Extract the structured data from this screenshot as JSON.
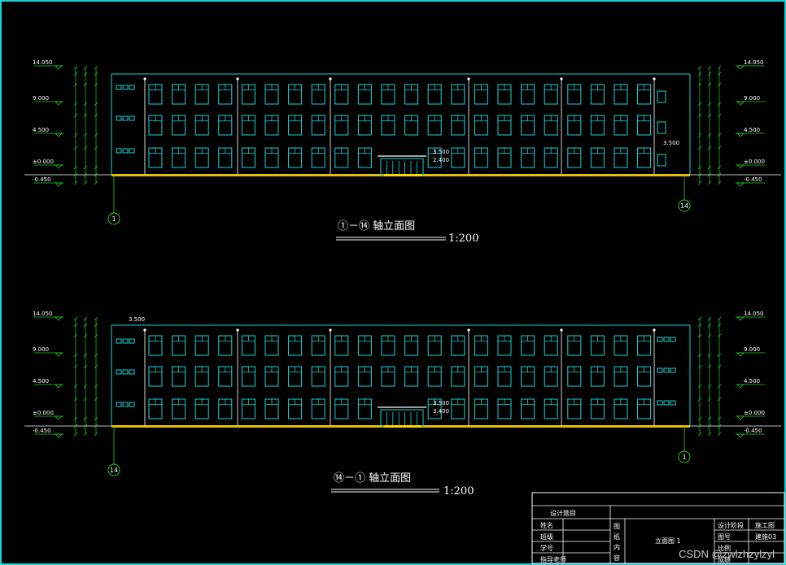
{
  "elevation_top": {
    "title": "①－⑭  轴立面图",
    "scale": "1:200",
    "axis_left": "1",
    "axis_right": "14",
    "levels_left": [
      "14.050",
      "9.000",
      "4.500",
      "±0.000",
      "-0.450"
    ],
    "levels_right": [
      "14.050",
      "9.000",
      "4.500",
      "±0.000",
      "-0.450"
    ],
    "entrance_levels": [
      "3.500",
      "2.400"
    ],
    "side_level": "3.500"
  },
  "elevation_bottom": {
    "title": "⑭－①  轴立面图",
    "scale": "1:200",
    "axis_left": "14",
    "axis_right": "1",
    "levels_left": [
      "14.050",
      "9.000",
      "4.500",
      "±0.000",
      "-0.450"
    ],
    "levels_right": [
      "14.050",
      "9.000",
      "4.500",
      "±0.000",
      "-0.450"
    ],
    "entrance_levels": [
      "3.500",
      "3.400"
    ],
    "side_level": "3.500"
  },
  "title_block": {
    "header": "设计题目",
    "rows": [
      "姓名",
      "班级",
      "学号",
      "指导老师"
    ],
    "content_label": [
      "图",
      "纸",
      "内",
      "容"
    ],
    "drawing_name": "立面图 1",
    "right_labels": [
      "设计阶段",
      "图号",
      "比例",
      "成绩"
    ],
    "right_values": [
      "施工图",
      "建施03",
      "",
      ""
    ]
  },
  "watermark": "CSDN @zwlzhzylzyl",
  "colors": {
    "line": "#16d4d4",
    "dim": "#22cc22",
    "text": "#ffffff",
    "ground": "#ffd400"
  }
}
